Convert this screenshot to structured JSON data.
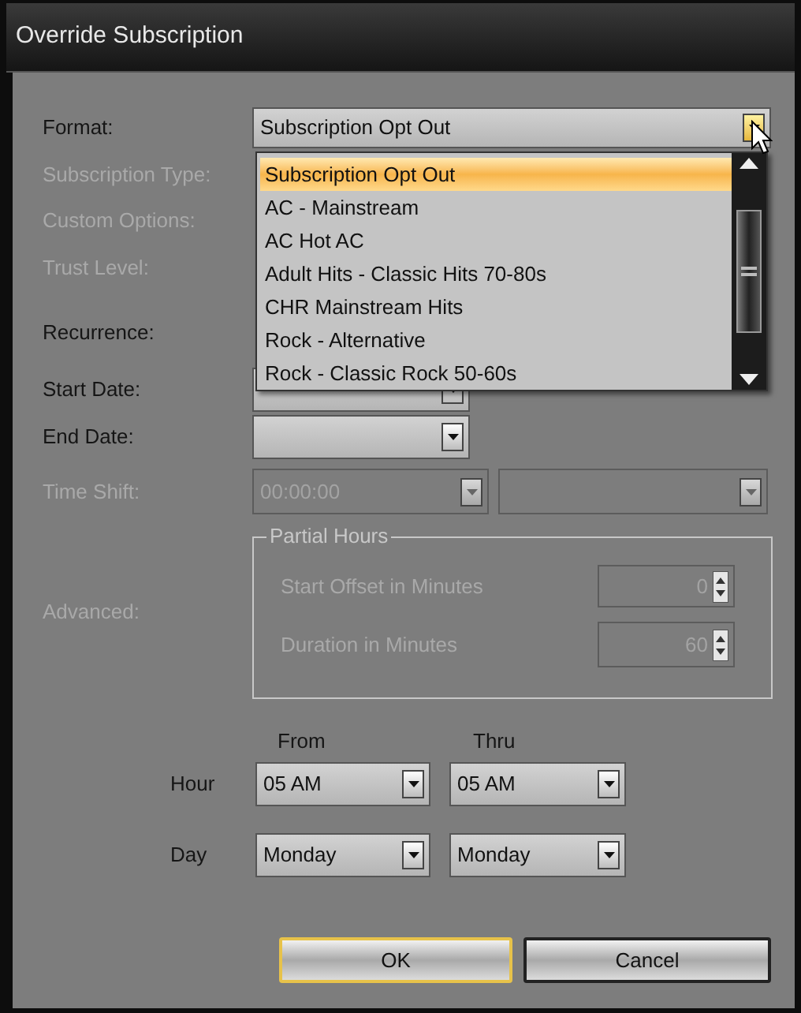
{
  "window": {
    "title": "Override Subscription"
  },
  "format": {
    "label": "Format:",
    "value": "Subscription Opt Out",
    "hovered": true,
    "open": true,
    "options": [
      {
        "label": "Subscription Opt Out",
        "selected": true
      },
      {
        "label": "AC - Mainstream",
        "selected": false
      },
      {
        "label": "AC Hot AC",
        "selected": false
      },
      {
        "label": "Adult Hits - Classic Hits 70-80s",
        "selected": false
      },
      {
        "label": "CHR Mainstream Hits",
        "selected": false
      },
      {
        "label": "Rock - Alternative",
        "selected": false
      },
      {
        "label": "Rock - Classic Rock 50-60s",
        "selected": false
      }
    ]
  },
  "rows": [
    {
      "label": "Subscription Type:",
      "disabled": true
    },
    {
      "label": "Custom Options:",
      "disabled": true
    },
    {
      "label": "Trust Level:",
      "disabled": true
    },
    {
      "label": "Recurrence:",
      "disabled": false
    }
  ],
  "start_date": {
    "label": "Start Date:",
    "disabled": false
  },
  "end_date": {
    "label": "End Date:",
    "disabled": false
  },
  "time_shift": {
    "label": "Time Shift:",
    "disabled": true,
    "value": "00:00:00"
  },
  "advanced": {
    "label": "Advanced:",
    "disabled": true,
    "group_title": "Partial Hours",
    "spinners": [
      {
        "label": "Start Offset in Minutes",
        "value": "0"
      },
      {
        "label": "Duration in Minutes",
        "value": "60"
      }
    ]
  },
  "schedule": {
    "from": "From",
    "thru": "Thru",
    "rows": [
      {
        "label": "Hour",
        "from": "05 AM",
        "thru": "05 AM"
      },
      {
        "label": "Day",
        "from": "Monday",
        "thru": "Monday"
      }
    ]
  },
  "buttons": [
    {
      "label": "OK",
      "default": true
    },
    {
      "label": "Cancel",
      "default": false
    }
  ]
}
